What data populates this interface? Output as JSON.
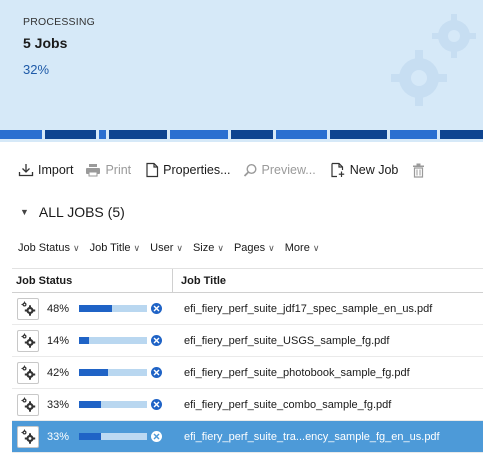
{
  "processing": {
    "label": "PROCESSING",
    "jobs": "5 Jobs",
    "percent": "32%"
  },
  "colors": {
    "panel_bg": "#d6e9f8",
    "accent": "#1f63c6",
    "bar_track": "#b9d7f0",
    "selected_row": "#4d9ad8"
  },
  "toolbar": {
    "import_label": "Import",
    "print_label": "Print",
    "properties_label": "Properties...",
    "preview_label": "Preview...",
    "newjob_label": "New Job"
  },
  "all_jobs": {
    "label": "ALL JOBS (5)"
  },
  "filters": [
    {
      "label": "Job Status"
    },
    {
      "label": "Job Title"
    },
    {
      "label": "User"
    },
    {
      "label": "Size"
    },
    {
      "label": "Pages"
    },
    {
      "label": "More"
    }
  ],
  "table": {
    "headers": {
      "status": "Job Status",
      "title": "Job Title"
    },
    "rows": [
      {
        "percent": "48%",
        "progress": 0.48,
        "title": "efi_fiery_perf_suite_jdf17_spec_sample_en_us.pdf",
        "selected": false
      },
      {
        "percent": "14%",
        "progress": 0.14,
        "title": "efi_fiery_perf_suite_USGS_sample_fg.pdf",
        "selected": false
      },
      {
        "percent": "42%",
        "progress": 0.42,
        "title": "efi_fiery_perf_suite_photobook_sample_fg.pdf",
        "selected": false
      },
      {
        "percent": "33%",
        "progress": 0.33,
        "title": "efi_fiery_perf_suite_combo_sample_fg.pdf",
        "selected": false
      },
      {
        "percent": "33%",
        "progress": 0.33,
        "title": "efi_fiery_perf_suite_tra...ency_sample_fg_en_us.pdf",
        "selected": true
      }
    ]
  }
}
